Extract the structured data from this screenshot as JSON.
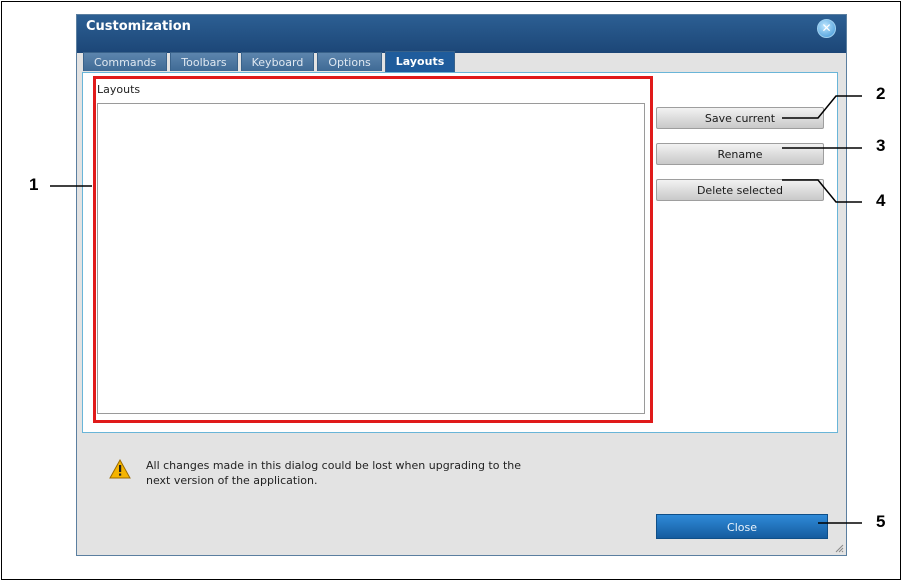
{
  "window": {
    "title": "Customization",
    "close_glyph": "✕"
  },
  "tabs": [
    {
      "label": "Commands",
      "active": false
    },
    {
      "label": "Toolbars",
      "active": false
    },
    {
      "label": "Keyboard",
      "active": false
    },
    {
      "label": "Options",
      "active": false
    },
    {
      "label": "Layouts",
      "active": true
    }
  ],
  "layouts": {
    "list_label": "Layouts",
    "items": [],
    "highlight_color": "#e01a1a"
  },
  "buttons": {
    "save_current": "Save current",
    "rename": "Rename",
    "delete_selected": "Delete selected"
  },
  "warning": {
    "icon": "warning-triangle-icon",
    "text": "All changes made in this dialog could be lost when upgrading to the next version of the application."
  },
  "footer": {
    "close_label": "Close"
  },
  "callouts": {
    "c1": "1",
    "c2": "2",
    "c3": "3",
    "c4": "4",
    "c5": "5"
  }
}
